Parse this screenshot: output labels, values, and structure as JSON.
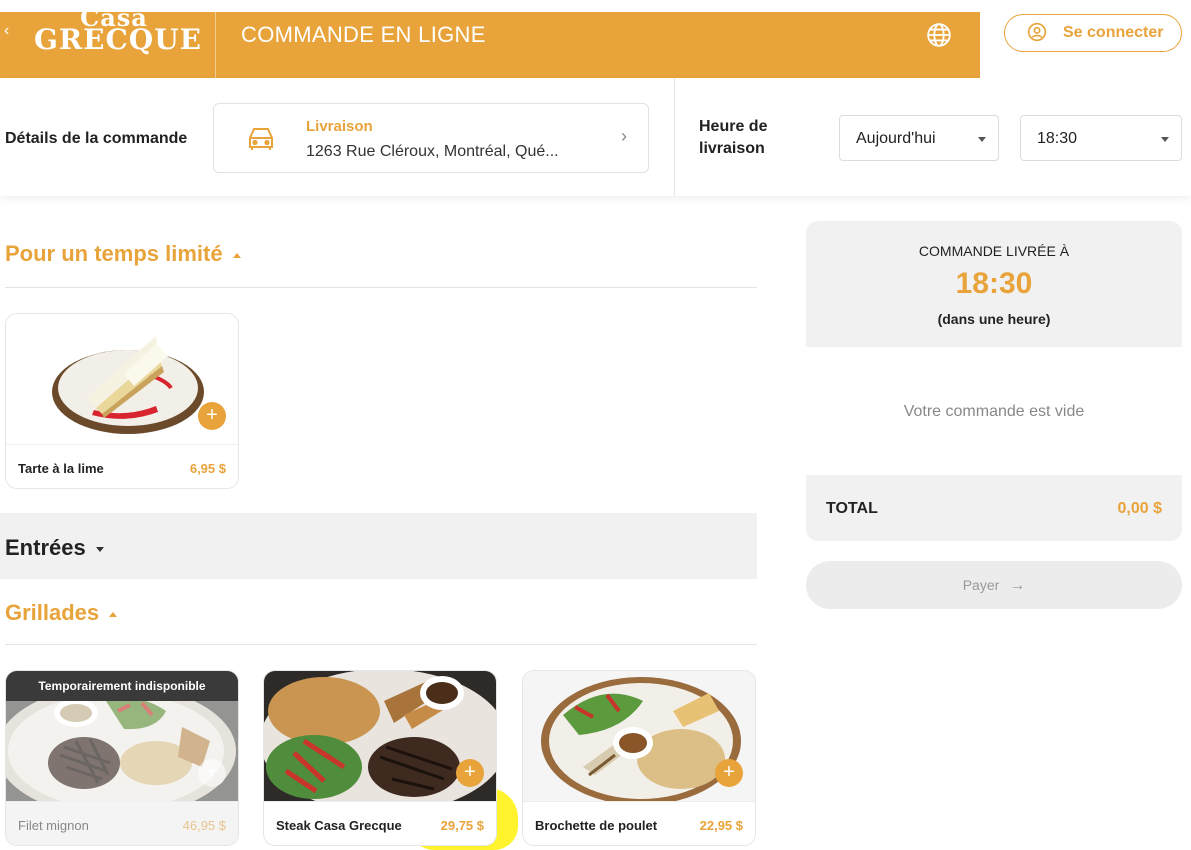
{
  "header": {
    "back_glyph": "‹",
    "logo_line1": "Casa",
    "logo_line2": "GRECQUE",
    "title": "COMMANDE EN LIGNE",
    "language_icon": "globe-icon",
    "login_label": "Se connecter",
    "login_icon": "user-circle-icon",
    "brand_color": "#e8a33a"
  },
  "order": {
    "details_label": "Détails de la commande",
    "delivery_type": "Livraison",
    "delivery_address": "1263 Rue Cléroux, Montréal, Qué...",
    "delivery_icon": "car-icon",
    "chevron": "›",
    "time_label_line1": "Heure de",
    "time_label_line2": "livraison",
    "day_selected": "Aujourd'hui",
    "time_selected": "18:30"
  },
  "sections": {
    "limited": {
      "title": "Pour un temps limité",
      "items": [
        {
          "name": "Tarte à la lime",
          "price": "6,95 $",
          "add": "+"
        }
      ]
    },
    "entrees": {
      "title": "Entrées"
    },
    "grillades": {
      "title": "Grillades",
      "items": [
        {
          "name": "Filet mignon",
          "price": "46,95 $",
          "badge": "Temporairement indisponible",
          "add": "+"
        },
        {
          "name": "Steak Casa Grecque",
          "price": "29,75 $",
          "add": "+"
        },
        {
          "name": "Brochette de poulet",
          "price": "22,95 $",
          "add": "+"
        }
      ]
    }
  },
  "summary": {
    "delivered_label": "COMMANDE LIVRÉE À",
    "time": "18:30",
    "subtitle": "(dans une heure)",
    "empty_message": "Votre commande est vide",
    "total_label": "TOTAL",
    "total_value": "0,00 $",
    "pay_label": "Payer",
    "pay_arrow": "→"
  }
}
